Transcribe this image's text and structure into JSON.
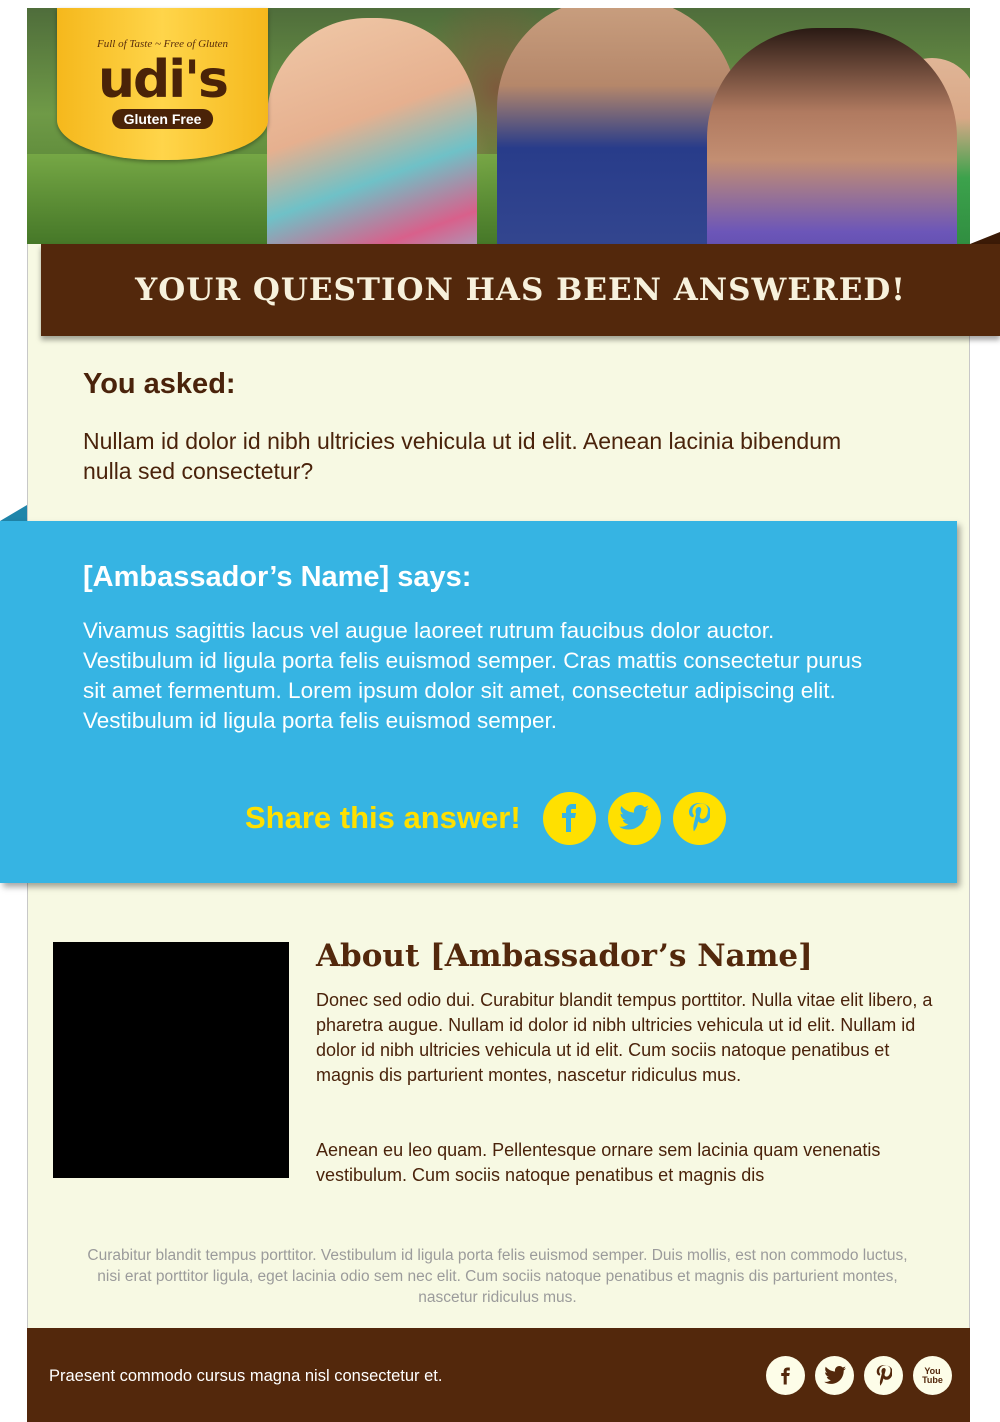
{
  "header": {
    "logo": {
      "tagline": "Full of Taste ~ Free of Gluten",
      "brand": "udi's",
      "subbrand": "Gluten Free"
    },
    "banner_title": "YOUR QUESTION HAS BEEN ANSWERED!"
  },
  "question": {
    "label": "You asked:",
    "text": "Nullam id dolor id nibh ultricies vehicula ut id elit. Aenean lacinia bibendum nulla sed consectetur?"
  },
  "answer": {
    "label": "[Ambassador’s Name] says:",
    "text": "Vivamus sagittis lacus vel augue laoreet rutrum faucibus dolor auctor. Vestibulum id ligula porta felis euismod semper. Cras mattis consectetur purus sit amet fermentum. Lorem ipsum dolor sit amet, consectetur adipiscing elit. Vestibulum id ligula porta felis euismod semper.",
    "share_label": "Share this answer!",
    "share_icons": [
      "facebook-icon",
      "twitter-icon",
      "pinterest-icon"
    ]
  },
  "about": {
    "title": "About [Ambassador’s Name]",
    "paragraph1": "Donec sed odio dui. Curabitur blandit tempus porttitor. Nulla vitae elit libero, a pharetra augue. Nullam id dolor id nibh ultricies vehicula ut id elit. Nullam id dolor id nibh ultricies vehicula ut id elit. Cum sociis natoque penatibus et magnis dis parturient montes, nascetur ridiculus mus.",
    "paragraph2": "Aenean eu leo quam. Pellentesque ornare sem lacinia quam venenatis vestibulum. Cum sociis natoque penatibus et magnis dis"
  },
  "fine_print": "Curabitur blandit tempus porttitor. Vestibulum id ligula porta felis euismod semper. Duis mollis, est non commodo luctus, nisi erat porttitor ligula, eget lacinia odio sem nec elit. Cum sociis natoque penatibus et magnis dis parturient montes, nascetur ridiculus mus.",
  "footer": {
    "text": "Praesent commodo cursus magna nisl consectetur et.",
    "social_icons": [
      "facebook-icon",
      "twitter-icon",
      "pinterest-icon",
      "youtube-icon"
    ],
    "youtube_label_top": "You",
    "youtube_label_bottom": "Tube"
  },
  "colors": {
    "brown": "#53280c",
    "cream": "#f7f9e3",
    "blue": "#36b4e3",
    "yellow": "#ffe000",
    "logo_yellow": "#f5b81c"
  }
}
